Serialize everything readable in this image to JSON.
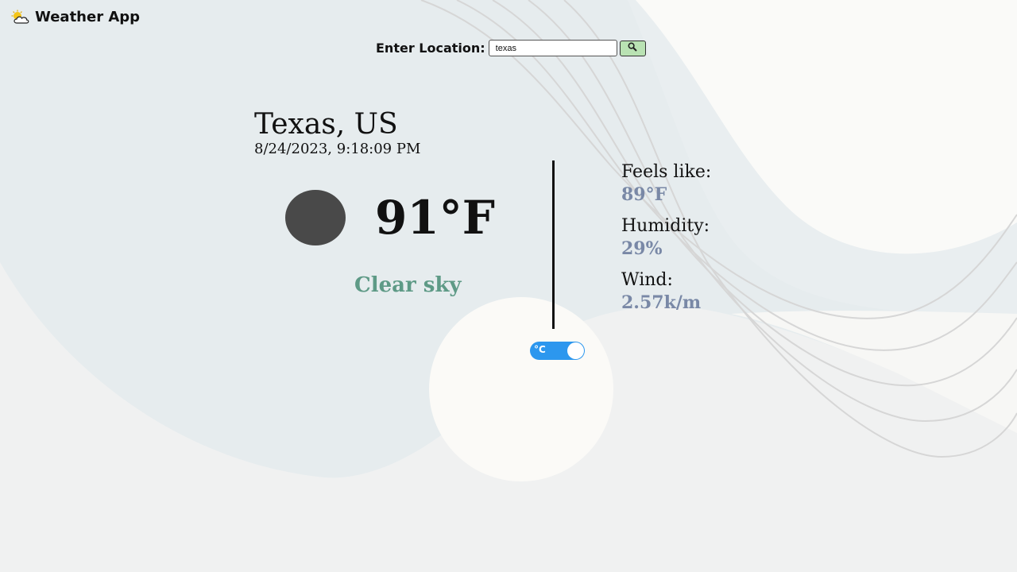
{
  "header": {
    "title": "Weather App",
    "logo_icon": "cloud-sun-icon"
  },
  "search": {
    "label": "Enter Location:",
    "value": "texas",
    "button_icon": "search-icon"
  },
  "location": {
    "city": "Texas, US",
    "datetime": "8/24/2023, 9:18:09 PM"
  },
  "current": {
    "temperature": "91°F",
    "description": "Clear sky",
    "icon": "weather-condition-icon"
  },
  "toggle": {
    "label": "°C",
    "state": "on"
  },
  "details": {
    "feels_like_label": "Feels like:",
    "feels_like_value": "89°F",
    "humidity_label": "Humidity:",
    "humidity_value": "29%",
    "wind_label": "Wind:",
    "wind_value": "2.57k/m"
  },
  "colors": {
    "accent_text": "#7988a6",
    "description": "#5e9a86",
    "toggle": "#2c97ee",
    "search_button": "#b9e2b3"
  }
}
